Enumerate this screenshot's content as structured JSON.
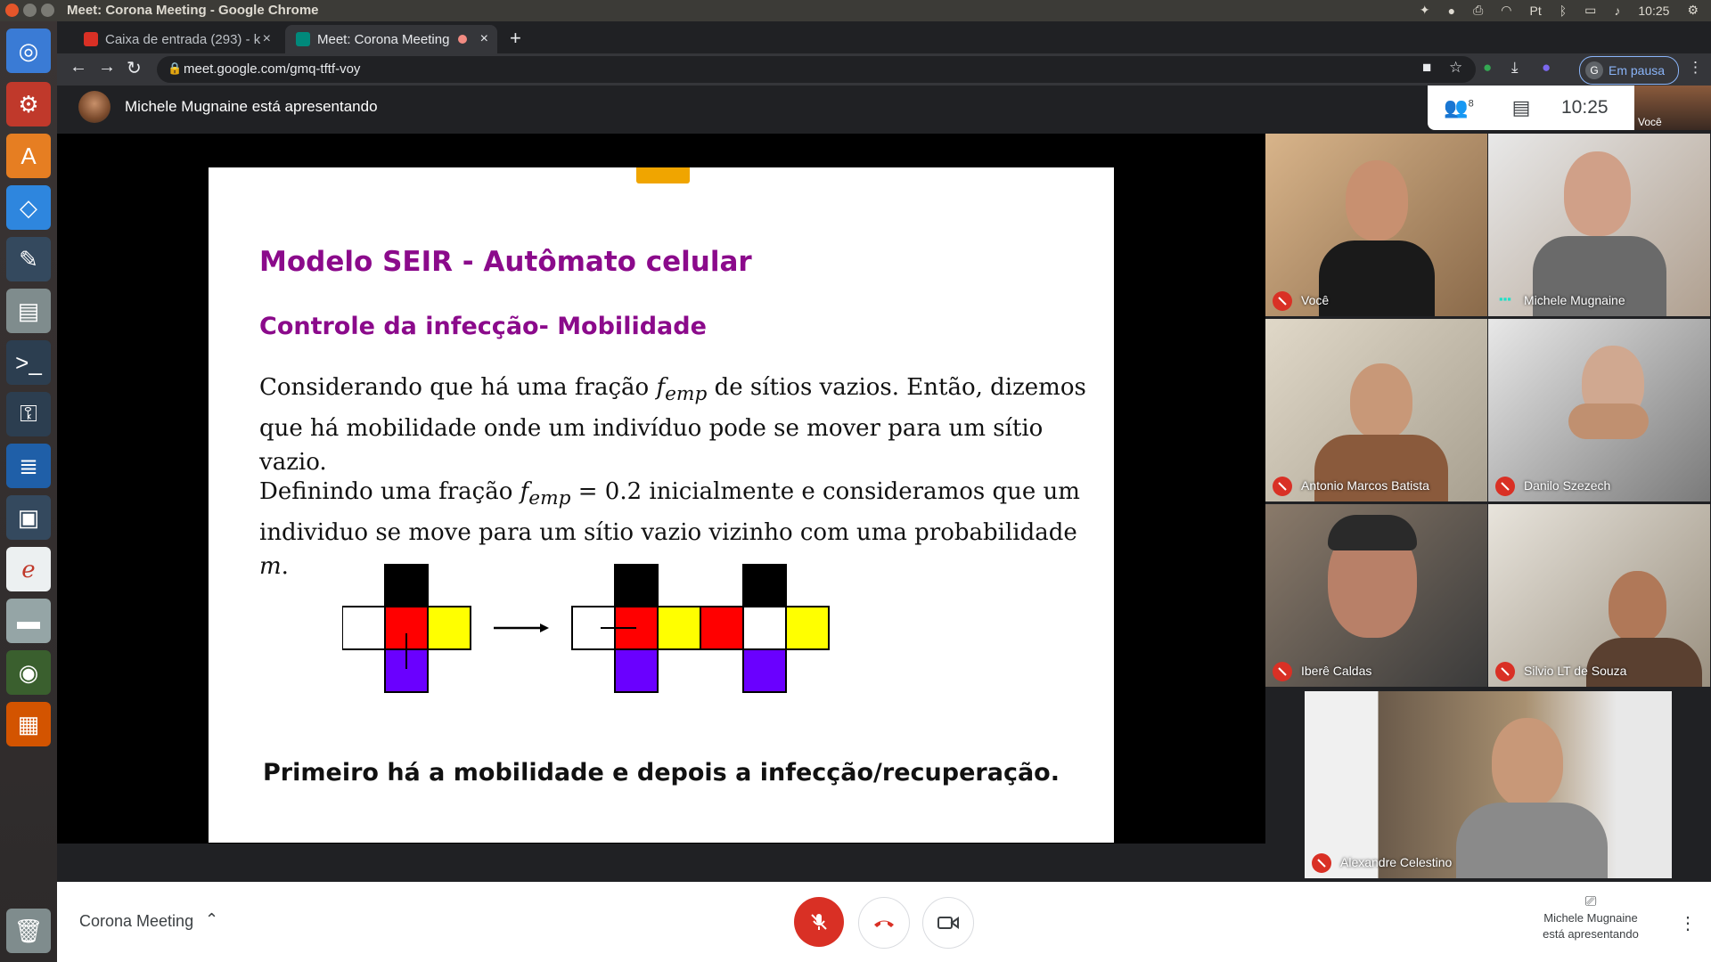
{
  "os": {
    "window_title": "Meet: Corona Meeting - Google Chrome",
    "clock": "10:25"
  },
  "launcher": {
    "items": [
      "ubuntu-dash-icon",
      "settings-icon",
      "software-center-icon",
      "dropbox-icon",
      "text-editor-icon",
      "file-manager-icon",
      "terminal-icon",
      "disk-icon",
      "writer-icon",
      "window-icon",
      "pdf-viewer-icon",
      "drive-icon",
      "chrome-icon",
      "impress-icon",
      "trash-icon"
    ]
  },
  "browser": {
    "tabs": [
      {
        "label": "Caixa de entrada (293) - k",
        "close": "×"
      },
      {
        "label": "Meet: Corona Meeting",
        "close": "×"
      }
    ],
    "new_tab": "+",
    "url": "meet.google.com/gmq-tftf-voy",
    "profile_initial": "G",
    "profile_status": "Em pausa"
  },
  "meet": {
    "presenter_banner": "Michele Mugnaine está apresentando",
    "participants_count": "8",
    "clock": "10:25",
    "self_label": "Você",
    "meeting_name": "Corona Meeting",
    "present_status_line1": "Michele Mugnaine",
    "present_status_line2": "está apresentando",
    "participants": [
      {
        "name": "Você",
        "muted": true
      },
      {
        "name": "Michele Mugnaine",
        "muted": false
      },
      {
        "name": "Antonio Marcos Batista",
        "muted": true
      },
      {
        "name": "Danilo Szezech",
        "muted": true
      },
      {
        "name": "Iberê Caldas",
        "muted": true
      },
      {
        "name": "Silvio LT de Souza",
        "muted": true
      },
      {
        "name": "Alexandre Celestino",
        "muted": true
      }
    ]
  },
  "slide": {
    "title": "Modelo SEIR - Autômato celular",
    "subtitle": "Controle da infecção- Mobilidade",
    "p1_a": "Considerando que há uma fração ",
    "p1_var": "f",
    "p1_sub": "emp",
    "p1_b": " de sítios vazios. Então, dizemos que há mobilidade onde um indivíduo pode se mover para um sítio vazio.",
    "p2_a": "Definindo uma fração ",
    "p2_var": "f",
    "p2_sub": "emp",
    "p2_eq": " = 0.2",
    "p2_b": " inicialmente e consideramos que um individuo se move para um sítio vazio vizinho com uma probabilidade ",
    "p2_m": "m",
    "p2_end": ".",
    "bottom": "Primeiro há a mobilidade e depois a infecção/recuperação.",
    "colors": {
      "accent": "#8b0a8b",
      "black": "#000000",
      "red": "#ff0000",
      "yellow": "#ffff00",
      "purple": "#6a00ff",
      "white": "#ffffff"
    }
  }
}
